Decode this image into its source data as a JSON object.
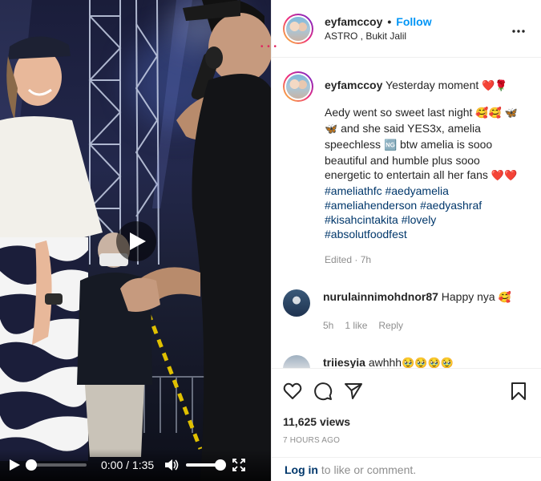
{
  "video": {
    "time_current": "0:00",
    "time_sep": " / ",
    "time_total": "1:35",
    "progress_fraction": 0.0,
    "volume_fraction": 1.0
  },
  "header": {
    "username": "eyfamccoy",
    "separator": "•",
    "follow_label": "Follow",
    "location": "ASTRO , Bukit Jalil"
  },
  "caption": {
    "username": "eyfamccoy",
    "title_text": "Yesterday moment",
    "title_emoji": "❤️🌹",
    "body_part1": "Aedy went so sweet last night",
    "emoji1": "🥰🥰 🦋🦋",
    "body_part2": "and she said YES3x, amelia speechless",
    "emoji2": "🆖",
    "body_part3": "btw amelia is sooo beautiful and humble plus sooo energetic to entertain all her fans",
    "emoji3": "❤️❤️",
    "hashtags": [
      "#ameliathfc",
      "#aedyamelia",
      "#ameliahenderson",
      "#aedyashraf",
      "#kisahcintakita",
      "#lovely",
      "#absolutfoodfest"
    ],
    "edited": "Edited",
    "age": "7h"
  },
  "comments": [
    {
      "username": "nurulainnimohdnor87",
      "text": "Happy nya",
      "emoji": "🥰",
      "age": "5h",
      "likes": "1 like",
      "reply_label": "Reply"
    },
    {
      "username": "triiesyia",
      "text": "awhhh",
      "emoji": "🥹🥹🥹🥹"
    }
  ],
  "stats": {
    "views": "11,625 views",
    "posted": "7 HOURS AGO"
  },
  "footer": {
    "login_label": "Log in",
    "rest": "to like or comment."
  },
  "icons": {
    "play": "play-icon",
    "volume": "volume-icon",
    "fullscreen": "fullscreen-icon",
    "more": "more-options-icon",
    "like": "heart-icon",
    "comment": "comment-icon",
    "share": "share-icon",
    "save": "bookmark-icon"
  },
  "colors": {
    "accent": "#0095f6",
    "link": "#00376b",
    "muted": "#8e8e8e",
    "text": "#262626"
  }
}
